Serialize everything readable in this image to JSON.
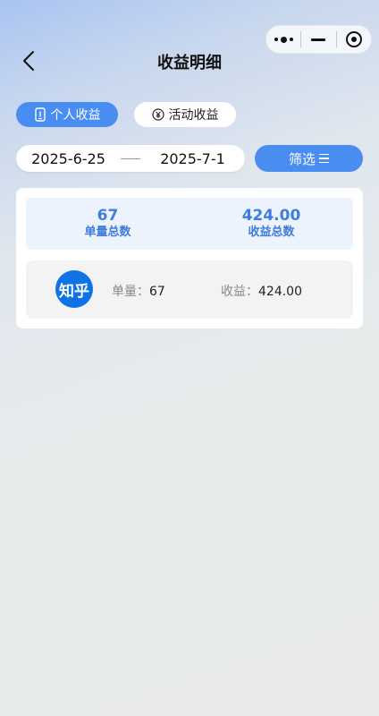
{
  "header": {
    "title": "收益明细"
  },
  "tabs": [
    {
      "label": "个人收益",
      "active": true
    },
    {
      "label": "活动收益",
      "active": false
    }
  ],
  "filter": {
    "start_date": "2025-6-25",
    "end_date": "2025-7-1",
    "button_label": "筛选"
  },
  "summary": {
    "order_total": "67",
    "order_total_label": "单量总数",
    "income_total": "424.00",
    "income_total_label": "收益总数"
  },
  "platforms": [
    {
      "logo_text": "知乎",
      "count_label": "单量：",
      "count": "67",
      "income_label": "收益：",
      "income": "424.00"
    }
  ],
  "colors": {
    "accent": "#4a8df1",
    "summary_text": "#3f7ddb",
    "zhihu_blue": "#0f73e6"
  },
  "icons": {
    "back": "chevron-left-icon",
    "more": "more-dots-icon",
    "minimize": "minimize-icon",
    "close": "target-circle-icon",
    "personal_tab": "phone-icon",
    "activity_tab": "yen-circle-icon",
    "filter": "menu-lines-icon"
  }
}
